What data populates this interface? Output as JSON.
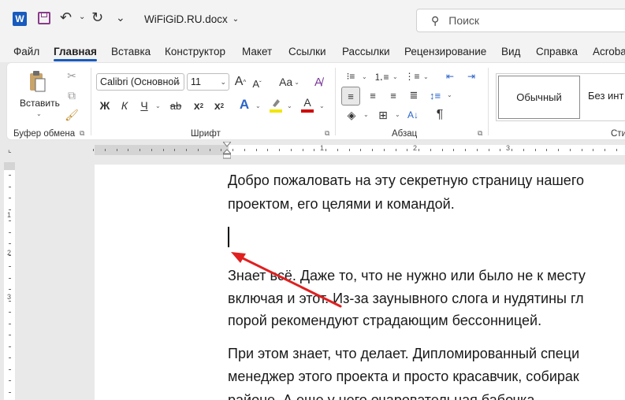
{
  "titlebar": {
    "doc_title": "WiFiGiD.RU.docx",
    "search_placeholder": "Поиск",
    "icons": [
      "word-logo-icon",
      "save-icon",
      "undo-icon",
      "redo-icon",
      "customize-qat-icon",
      "search-icon"
    ]
  },
  "tabs": [
    "Файл",
    "Главная",
    "Вставка",
    "Конструктор",
    "Макет",
    "Ссылки",
    "Рассылки",
    "Рецензирование",
    "Вид",
    "Справка",
    "Acroba"
  ],
  "active_tab": "Главная",
  "ribbon": {
    "clipboard": {
      "label": "Буфер обмена",
      "paste_label": "Вставить"
    },
    "font": {
      "label": "Шрифт",
      "font_name": "Calibri (Основной",
      "font_size": "11",
      "bold": "Ж",
      "italic": "К",
      "underline": "Ч",
      "strike": "ab",
      "subscript": "x",
      "superscript": "x",
      "change_case": "Aa",
      "grow": "A",
      "shrink": "A",
      "text_effects": "A",
      "highlight_color": "#f2e600",
      "font_color": "#d00000",
      "font_color_letter": "A"
    },
    "paragraph": {
      "label": "Абзац",
      "pilcrow": "¶"
    },
    "styles": {
      "normal": "Обычный",
      "no_spacing": "Без инт",
      "label": "Сти"
    }
  },
  "ruler": {
    "h_numbers": [
      "1",
      "2",
      "3"
    ],
    "v_numbers": [
      "1",
      "2",
      "3"
    ]
  },
  "document": {
    "lines": [
      "Добро пожаловать на эту секретную страницу нашего",
      "проектом, его целями и командой.",
      "",
      "Знает всё. Даже то, что не нужно или было не к месту",
      "включая и этот. Из-за заунывного слога и нудятины гл",
      "порой рекомендуют страдающим бессонницей.",
      "При этом знает, что делает. Дипломированный специ",
      "менеджер этого проекта и просто красавчик, собирак",
      "районе. А еще у него очаровательная бабочка."
    ],
    "arrow_color": "#e02020"
  }
}
